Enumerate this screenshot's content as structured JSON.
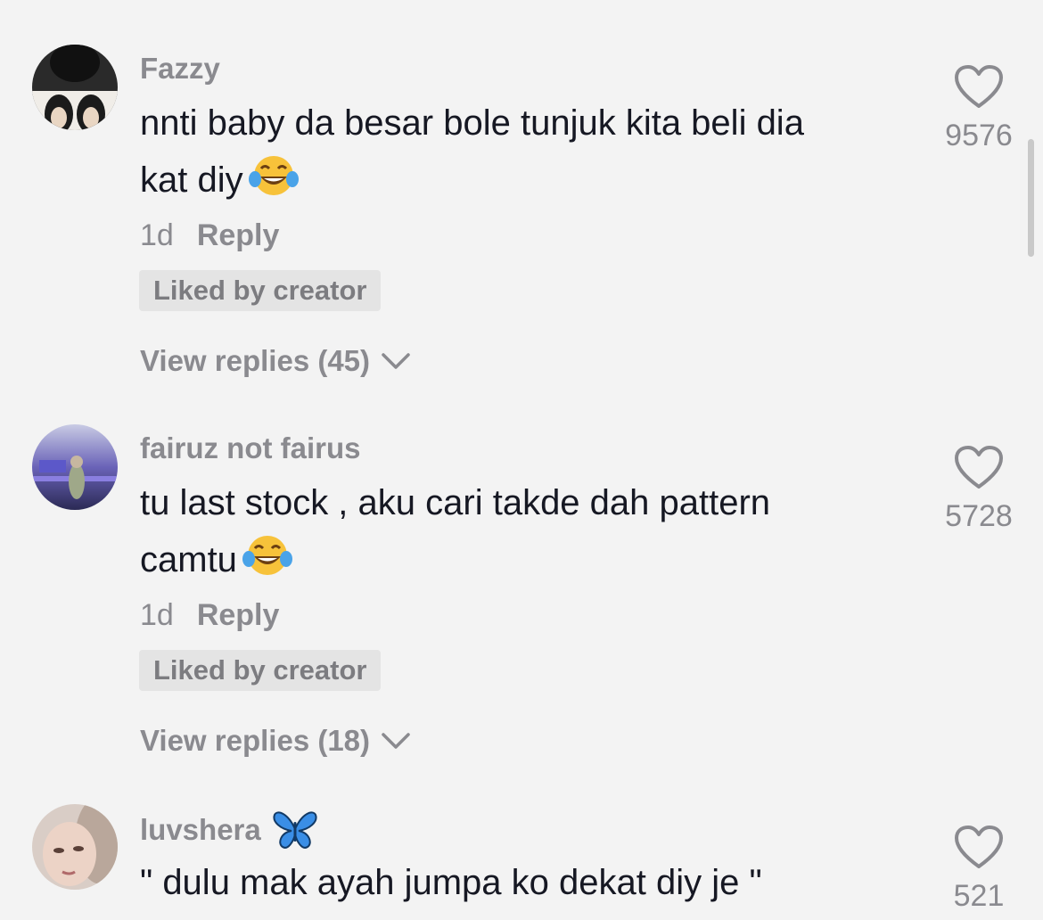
{
  "comments": [
    {
      "username": "Fazzy",
      "text_line1": "nnti baby da besar bole tunjuk kita beli dia",
      "text_line2": "kat diy",
      "emoji": "tears-of-joy-emoji",
      "time": "1d",
      "reply_label": "Reply",
      "liked_badge": "Liked by creator",
      "view_replies": "View replies (45)",
      "likes": "9576"
    },
    {
      "username": "fairuz not fairus",
      "text_line1": "tu last stock , aku cari takde dah pattern",
      "text_line2": "camtu",
      "emoji": "tears-of-joy-emoji",
      "time": "1d",
      "reply_label": "Reply",
      "liked_badge": "Liked by creator",
      "view_replies": "View replies (18)",
      "likes": "5728"
    },
    {
      "username": "luvshera",
      "username_emoji": "butterfly-emoji",
      "text_line1": "\" dulu mak ayah jumpa ko dekat diy je \"",
      "likes": "521"
    }
  ],
  "colors": {
    "background": "#f3f3f3",
    "text": "#161823",
    "muted": "#8a8a8f",
    "badge": "#e4e4e4"
  }
}
